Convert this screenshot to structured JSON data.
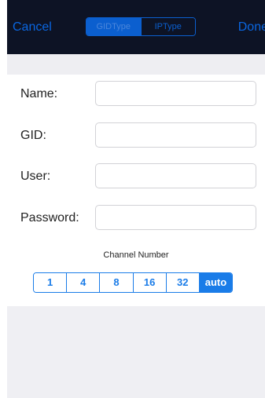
{
  "navbar": {
    "cancel_label": "Cancel",
    "done_label": "Done",
    "type_segments": [
      {
        "label": "GIDType",
        "selected": true
      },
      {
        "label": "IPType",
        "selected": false
      }
    ]
  },
  "form": {
    "fields": [
      {
        "label": "Name:",
        "value": "",
        "placeholder": ""
      },
      {
        "label": "GID:",
        "value": "",
        "placeholder": ""
      },
      {
        "label": "User:",
        "value": "",
        "placeholder": ""
      },
      {
        "label": "Password:",
        "value": "",
        "placeholder": ""
      }
    ]
  },
  "channel": {
    "title": "Channel Number",
    "options": [
      "1",
      "4",
      "8",
      "16",
      "32",
      "auto"
    ],
    "selected": "auto"
  },
  "colors": {
    "navbar_bg": "#0d1325",
    "accent": "#1a7ce8",
    "nav_text": "#0a66e0"
  }
}
